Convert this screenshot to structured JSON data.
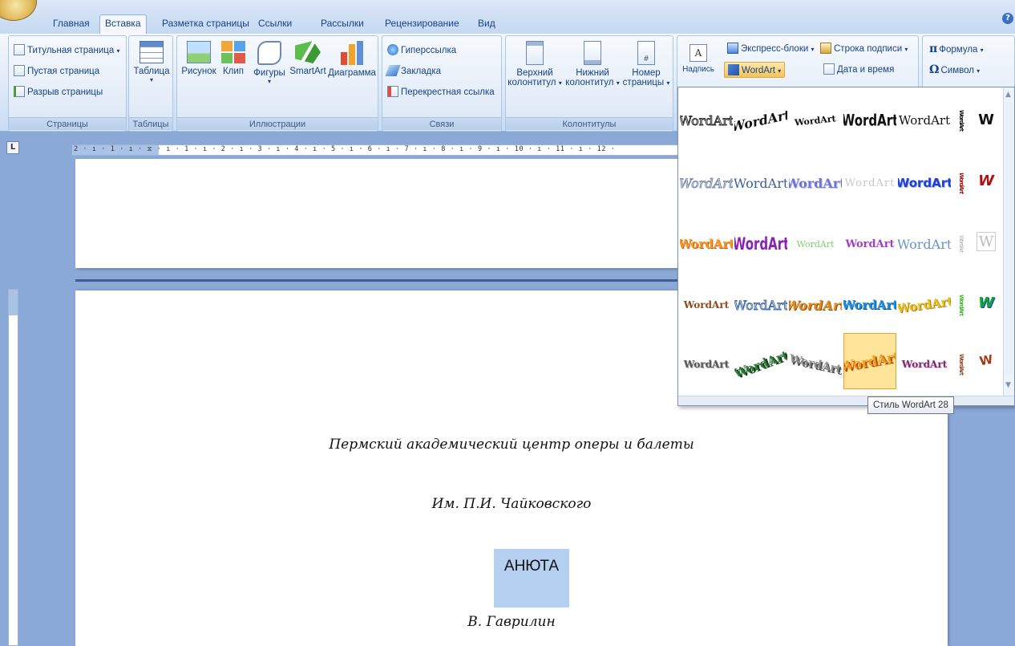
{
  "tabs": [
    "Главная",
    "Вставка",
    "Разметка страницы",
    "Ссылки",
    "Рассылки",
    "Рецензирование",
    "Вид"
  ],
  "active_tab": "Вставка",
  "ribbon": {
    "pages": {
      "label": "Страницы",
      "items": [
        "Титульная страница",
        "Пустая страница",
        "Разрыв страницы"
      ]
    },
    "tables": {
      "label": "Таблицы",
      "table": "Таблица"
    },
    "illustrations": {
      "label": "Иллюстрации",
      "items": [
        "Рисунок",
        "Клип",
        "Фигуры",
        "SmartArt",
        "Диаграмма"
      ]
    },
    "links": {
      "label": "Связи",
      "items": [
        "Гиперссылка",
        "Закладка",
        "Перекрестная ссылка"
      ]
    },
    "headers": {
      "label": "Колонтитулы",
      "header_top": "Верхний",
      "header_bottom": "колонтитул",
      "footer_top": "Нижний",
      "footer_bottom": "колонтитул",
      "pagenum_top": "Номер",
      "pagenum_bottom": "страницы"
    },
    "text": {
      "textbox_partial": "Надпись",
      "express": "Экспресс-блоки",
      "wordart": "WordArt",
      "signature": "Строка подписи",
      "datetime": "Дата и время"
    },
    "symbols": {
      "formula": "Формула",
      "symbol": "Символ"
    }
  },
  "ruler": {
    "corner": "L",
    "h_text": "2 · ı · 1 · ı · ⧖ · ı · 1 · ı · 2 · ı · 3 · ı · 4 · ı · 5 · ı · 6 · ı · 7 · ı · 8 · ı · 9 · ı · 10 · ı · 11 · ı · 12 ·"
  },
  "document": {
    "line1": "Пермский академический центр оперы и балеты",
    "line2": "Им. П.И. Чайковского",
    "selected": "АНЮТА",
    "line4": "В. Гаврилин"
  },
  "gallery": {
    "label": "WordArt",
    "vertical_label": "WordArt",
    "w_glyph": "W",
    "tooltip": "Стиль WordArt 28"
  }
}
